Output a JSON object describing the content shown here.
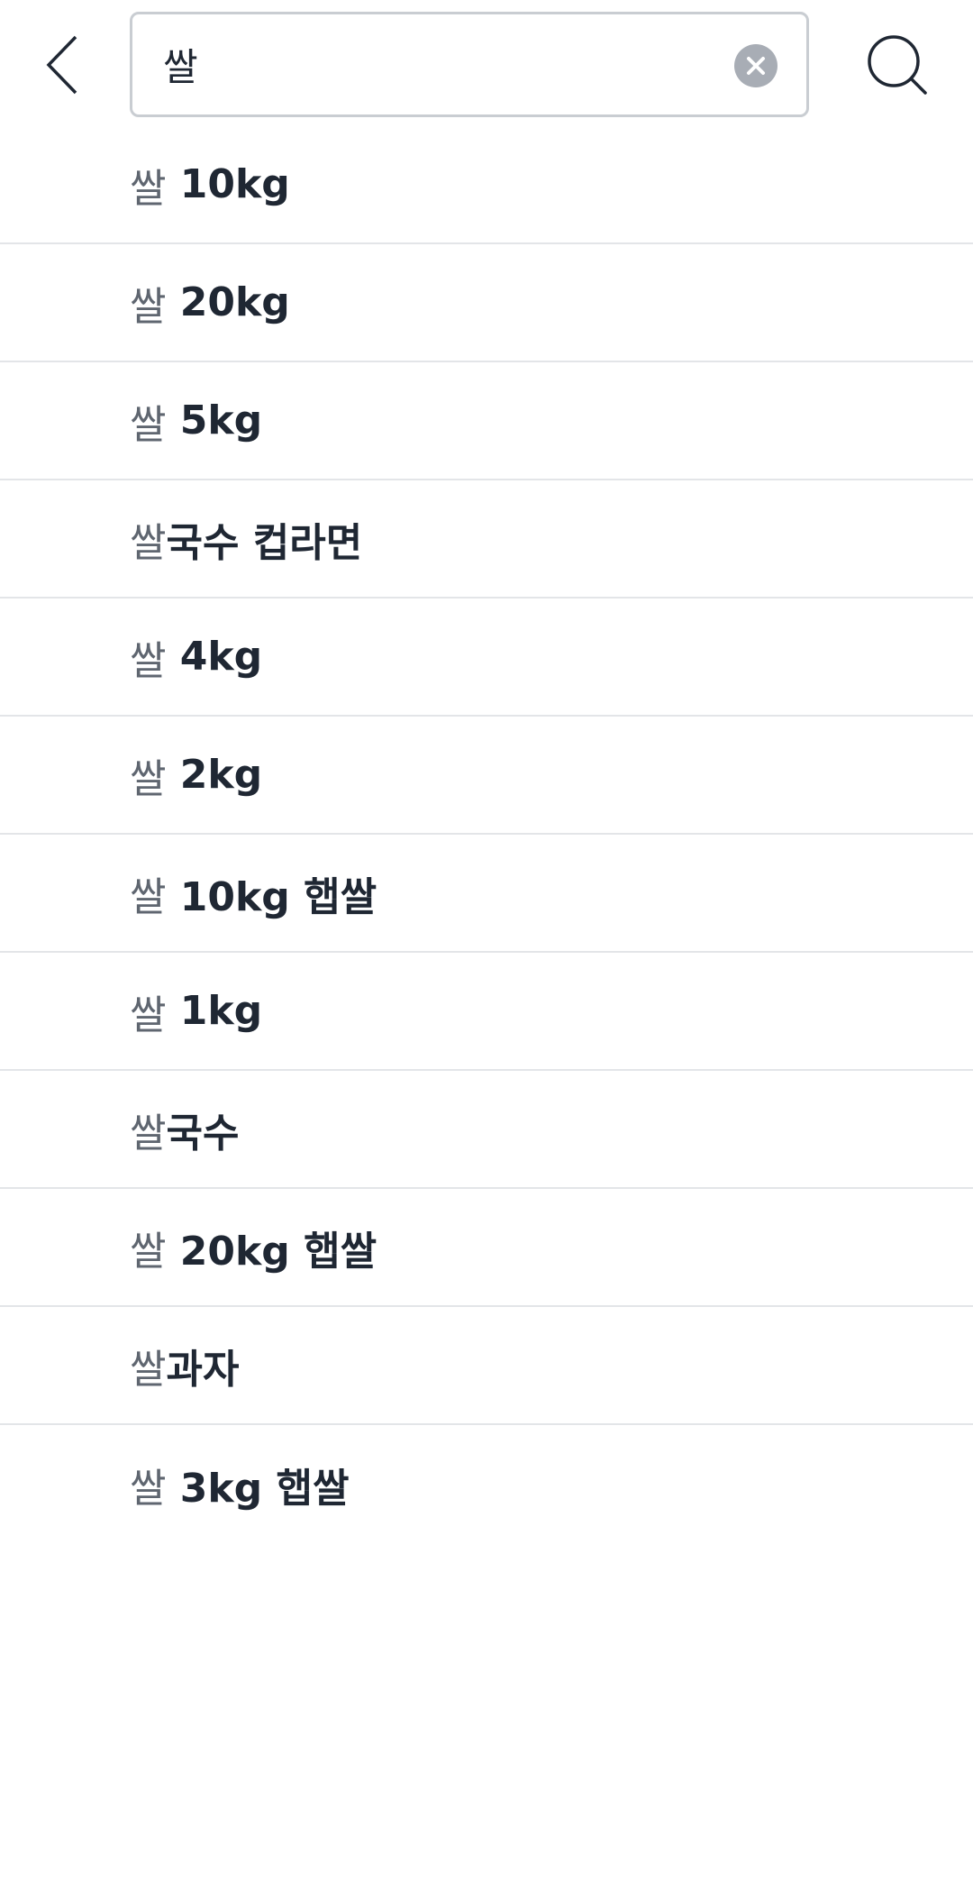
{
  "header": {
    "query": "쌀",
    "back_icon": "chevron-left-icon",
    "clear_icon": "close-icon",
    "search_icon": "search-icon"
  },
  "colors": {
    "text_primary": "#1f2733",
    "text_match": "#5f6670",
    "divider": "#e3e5e8",
    "clear_bg": "#a8adb5",
    "input_border": "#c9cdd2"
  },
  "suggestions": [
    {
      "match": "쌀",
      "rest": " 10kg"
    },
    {
      "match": "쌀",
      "rest": " 20kg"
    },
    {
      "match": "쌀",
      "rest": " 5kg"
    },
    {
      "match": "쌀",
      "rest": "국수 컵라면"
    },
    {
      "match": "쌀",
      "rest": " 4kg"
    },
    {
      "match": "쌀",
      "rest": " 2kg"
    },
    {
      "match": "쌀",
      "rest": " 10kg 햅쌀"
    },
    {
      "match": "쌀",
      "rest": " 1kg"
    },
    {
      "match": "쌀",
      "rest": "국수"
    },
    {
      "match": "쌀",
      "rest": " 20kg 햅쌀"
    },
    {
      "match": "쌀",
      "rest": "과자"
    },
    {
      "match": "쌀",
      "rest": " 3kg 햅쌀"
    }
  ]
}
